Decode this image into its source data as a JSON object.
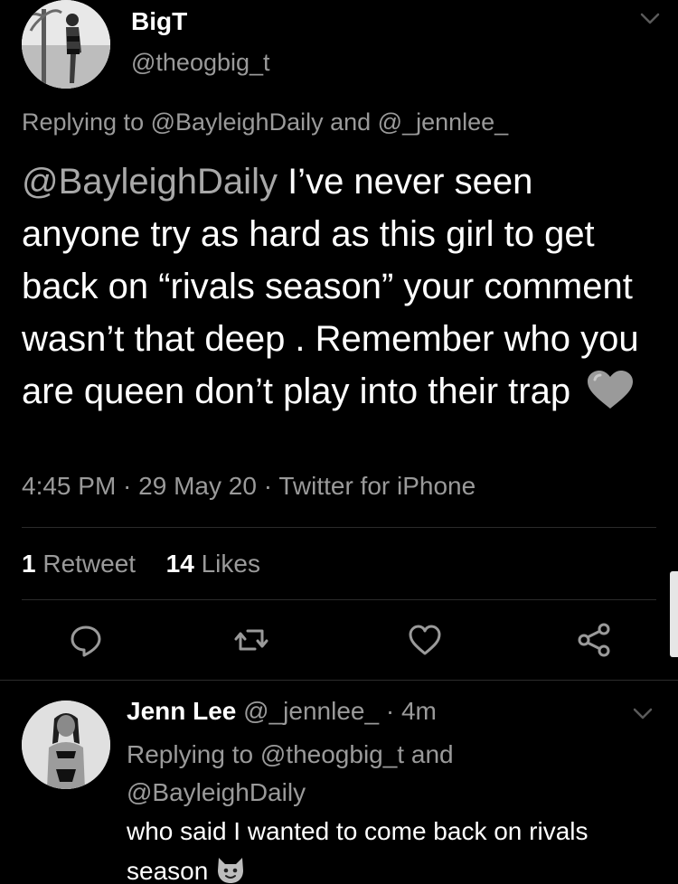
{
  "tweet": {
    "author_name": "BigT",
    "author_handle": "@theogbig_t",
    "replying_to_prefix": "Replying to ",
    "replying_to_1": "@BayleighDaily",
    "replying_to_and": " and ",
    "replying_to_2": "@_jennlee_",
    "mention": "@BayleighDaily",
    "text_after_mention": " I’ve never seen anyone try as hard as this girl to get back on “rivals season” your comment wasn’t that deep . Remember who you are queen don’t play into their trap",
    "emoji": "grey-heart",
    "time": "4:45 PM",
    "date": "29 May 20",
    "source": "Twitter for iPhone",
    "sep": " · ",
    "retweets_count": "1",
    "retweets_label": "Retweet",
    "likes_count": "14",
    "likes_label": "Likes"
  },
  "actions": [
    {
      "icon": "reply-icon"
    },
    {
      "icon": "retweet-icon"
    },
    {
      "icon": "like-icon"
    },
    {
      "icon": "share-icon"
    }
  ],
  "reply": {
    "author_name": "Jenn Lee",
    "author_handle": "@_jennlee_",
    "time_sep": " · ",
    "time": "4m",
    "replying_to_prefix": "Replying to ",
    "replying_to_1": "@theogbig_t",
    "replying_to_and": " and",
    "replying_to_2": "@BayleighDaily",
    "text": "who said I wanted to come back on rivals season",
    "emoji": "cat-emoji"
  },
  "colors": {
    "background": "#000000",
    "text_primary": "#ffffff",
    "text_secondary": "#9a9a9a",
    "divider": "#2b2b2b"
  }
}
